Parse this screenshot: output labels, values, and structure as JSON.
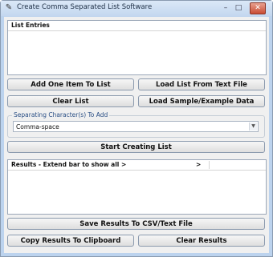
{
  "window": {
    "title": "Create Comma Separated List Software"
  },
  "title_buttons": {
    "minimize": "–",
    "maximize": "□",
    "close": "✕"
  },
  "list_entries": {
    "header": "List Entries"
  },
  "buttons": {
    "add_one_item": "Add One Item To List",
    "load_from_text": "Load List From Text File",
    "clear_list": "Clear List",
    "load_sample": "Load Sample/Example Data",
    "start_creating": "Start Creating List",
    "save_results": "Save Results To CSV/Text File",
    "copy_results": "Copy Results To Clipboard",
    "clear_results": "Clear Results"
  },
  "separator": {
    "group_label": "Separating Character(s) To Add",
    "selected": "Comma-space"
  },
  "results": {
    "header": "Results - Extend bar to show all >",
    "header_marker": ">"
  }
}
